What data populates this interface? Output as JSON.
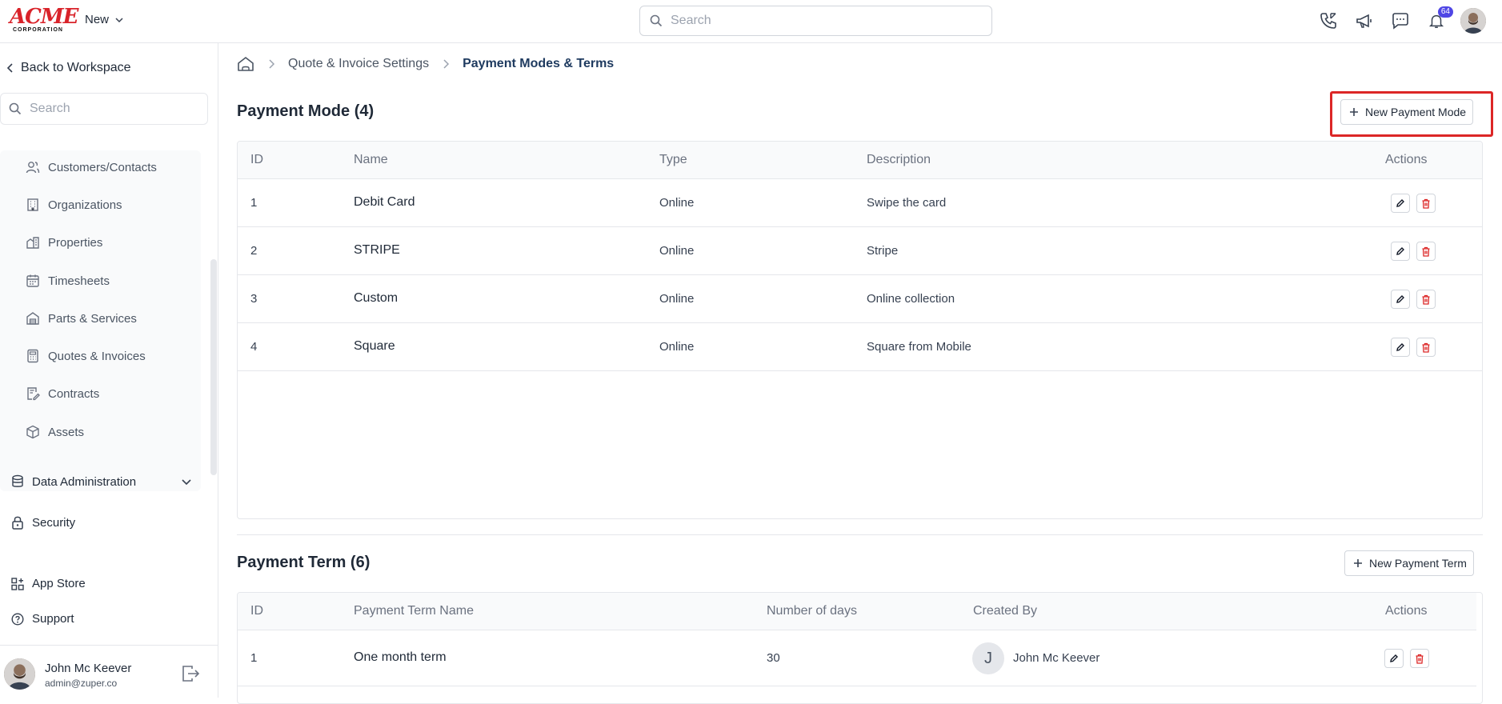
{
  "header": {
    "logo_main": "ACME",
    "logo_sub": "CORPORATION",
    "new_label": "New",
    "search_placeholder": "Search",
    "notification_count": "64"
  },
  "sidebar": {
    "back_label": "Back to Workspace",
    "search_placeholder": "Search",
    "sub_items": [
      {
        "label": "Customers/Contacts",
        "icon": "users-icon"
      },
      {
        "label": "Organizations",
        "icon": "building-icon"
      },
      {
        "label": "Properties",
        "icon": "property-icon"
      },
      {
        "label": "Timesheets",
        "icon": "calendar-icon"
      },
      {
        "label": "Parts & Services",
        "icon": "warehouse-icon"
      },
      {
        "label": "Quotes & Invoices",
        "icon": "calculator-icon"
      },
      {
        "label": "Contracts",
        "icon": "contract-icon"
      },
      {
        "label": "Assets",
        "icon": "cube-icon"
      }
    ],
    "data_admin_label": "Data Administration",
    "security_label": "Security",
    "app_store_label": "App Store",
    "support_label": "Support",
    "user": {
      "name": "John Mc Keever",
      "email": "admin@zuper.co"
    }
  },
  "breadcrumb": {
    "parent": "Quote & Invoice Settings",
    "current": "Payment Modes & Terms"
  },
  "payment_mode": {
    "title": "Payment Mode (4)",
    "new_button": "New Payment Mode",
    "columns": [
      "ID",
      "Name",
      "Type",
      "Description",
      "Actions"
    ],
    "rows": [
      {
        "id": "1",
        "name": "Debit Card",
        "type": "Online",
        "description": "Swipe the card"
      },
      {
        "id": "2",
        "name": "STRIPE",
        "type": "Online",
        "description": "Stripe"
      },
      {
        "id": "3",
        "name": "Custom",
        "type": "Online",
        "description": "Online collection"
      },
      {
        "id": "4",
        "name": "Square",
        "type": "Online",
        "description": "Square from Mobile"
      }
    ]
  },
  "payment_term": {
    "title": "Payment Term (6)",
    "new_button": "New Payment Term",
    "columns": [
      "ID",
      "Payment Term Name",
      "Number of days",
      "Created By",
      "Actions"
    ],
    "rows": [
      {
        "id": "1",
        "name": "One month term",
        "days": "30",
        "creator_initial": "J",
        "creator": "John Mc Keever"
      }
    ]
  },
  "colors": {
    "accent": "#4f46e5",
    "danger": "#dc2626",
    "breadcrumb_current": "#1e3a5f"
  }
}
